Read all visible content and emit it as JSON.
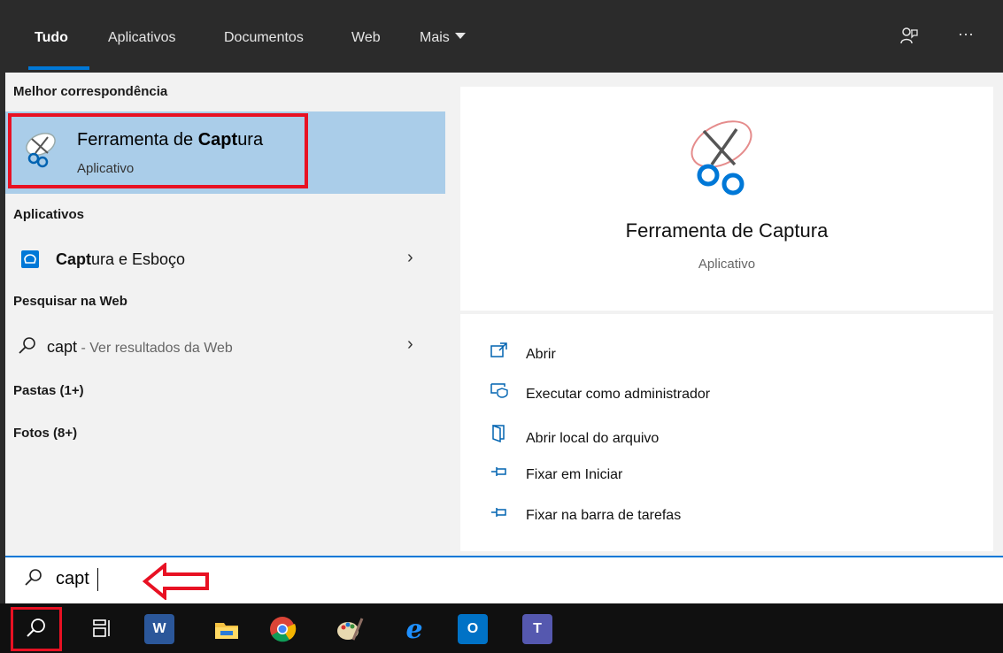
{
  "tabs": [
    {
      "label": "Tudo",
      "active": true
    },
    {
      "label": "Aplicativos"
    },
    {
      "label": "Documentos"
    },
    {
      "label": "Web"
    },
    {
      "label": "Mais"
    }
  ],
  "top_icons": {
    "feedback": "feedback-icon",
    "more": "···"
  },
  "left": {
    "best_match_header": "Melhor correspondência",
    "best_match": {
      "title_prefix": "Ferramenta de ",
      "title_bold": "Capt",
      "title_suffix": "ura",
      "subtitle": "Aplicativo"
    },
    "apps_header": "Aplicativos",
    "app_item": {
      "bold": "Capt",
      "rest": "ura e Esboço"
    },
    "web_header": "Pesquisar na Web",
    "web_item": {
      "query": "capt",
      "suffix": " - Ver resultados da Web"
    },
    "folders": "Pastas (1+)",
    "photos": "Fotos (8+)"
  },
  "right": {
    "app_name": "Ferramenta de Captura",
    "app_type": "Aplicativo",
    "actions": [
      {
        "icon": "open-icon",
        "label": "Abrir"
      },
      {
        "icon": "admin-shield-icon",
        "label": "Executar como administrador"
      },
      {
        "icon": "file-location-icon",
        "label": "Abrir local do arquivo"
      },
      {
        "icon": "pin-icon",
        "label": "Fixar em Iniciar"
      },
      {
        "icon": "pin-taskbar-icon",
        "label": "Fixar na barra de tarefas"
      }
    ]
  },
  "search": {
    "value": "capt"
  },
  "taskbar": {
    "icons": [
      "search-icon",
      "task-view-icon",
      "word-icon",
      "file-explorer-icon",
      "chrome-icon",
      "paint-icon",
      "ie-icon",
      "outlook-icon",
      "teams-icon"
    ],
    "word_letter": "W",
    "outlook_letter": "O",
    "teams_letter": "T"
  },
  "colors": {
    "accent": "#0078d7",
    "highlight": "#aacde9",
    "annotation_red": "#e81123"
  }
}
